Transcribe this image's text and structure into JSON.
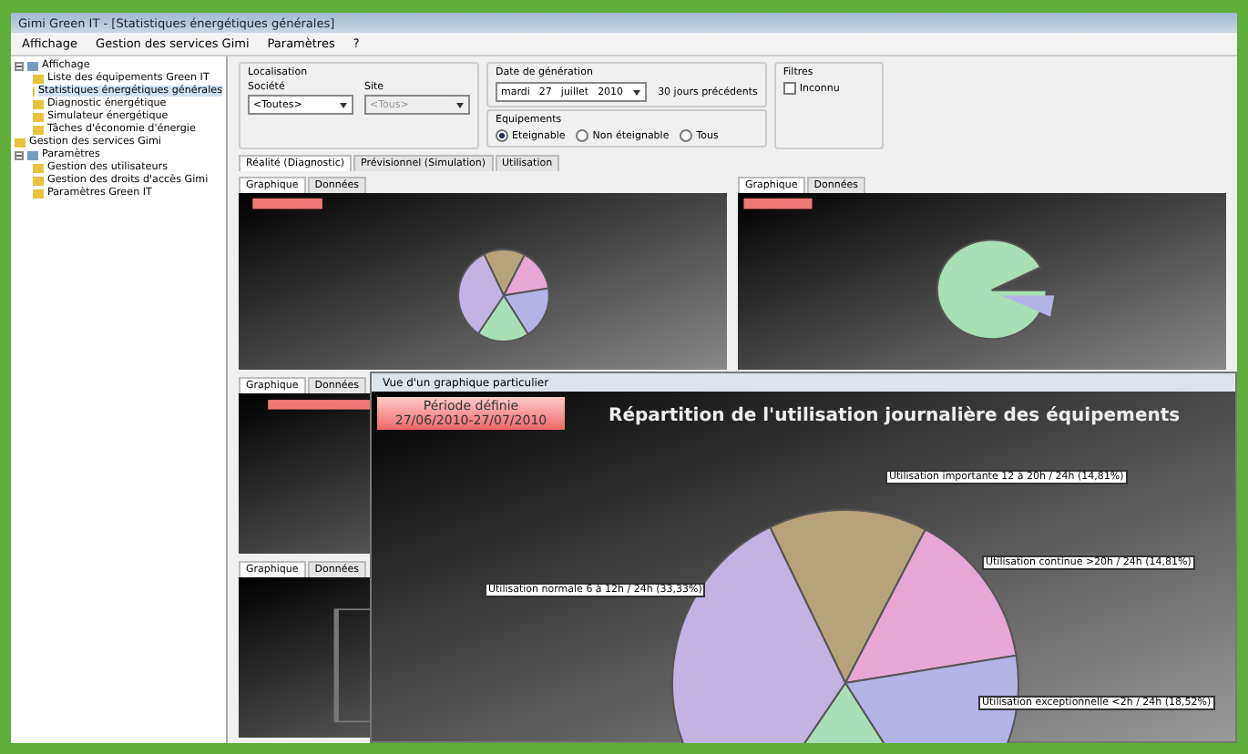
{
  "window": {
    "title": "Gimi Green IT - [Statistiques énergétiques générales]"
  },
  "menu": [
    "Affichage",
    "Gestion des services Gimi",
    "Paramètres",
    "?"
  ],
  "tree": [
    {
      "label": "Affichage",
      "expanded": true,
      "selected": false,
      "children": [
        {
          "label": "Liste des équipements Green IT",
          "selected": false
        },
        {
          "label": "Statistiques énergétiques générales",
          "selected": true
        },
        {
          "label": "Diagnostic énergétique",
          "selected": false
        },
        {
          "label": "Simulateur énergétique",
          "selected": false
        },
        {
          "label": "Tâches d'économie d'énergie",
          "selected": false
        }
      ]
    },
    {
      "label": "Gestion des services Gimi",
      "selected": false
    },
    {
      "label": "Paramètres",
      "expanded": true,
      "selected": false,
      "children": [
        {
          "label": "Gestion des utilisateurs",
          "selected": false
        },
        {
          "label": "Gestion des droits d'accès Gimi",
          "selected": false
        },
        {
          "label": "Paramètres Green IT",
          "selected": false
        }
      ]
    }
  ],
  "localisation": {
    "title": "Localisation",
    "fields": [
      {
        "label": "Société",
        "value": "<Toutes>",
        "disabled": false
      },
      {
        "label": "Site",
        "value": "<Tous>",
        "disabled": true
      }
    ]
  },
  "date": {
    "title": "Date de génération",
    "parts": [
      "mardi",
      "27",
      "juillet",
      "2010"
    ],
    "period": "30 jours précédents"
  },
  "equipements": {
    "title": "Equipements",
    "options": [
      {
        "label": "Eteignable",
        "selected": true
      },
      {
        "label": "Non éteignable",
        "selected": false
      },
      {
        "label": "Tous",
        "selected": false
      }
    ]
  },
  "filtres": {
    "title": "Filtres",
    "options": [
      {
        "label": "Inconnu",
        "checked": false
      }
    ]
  },
  "tabs": [
    {
      "label": "Réalité (Diagnostic)",
      "selected": true
    },
    {
      "label": "Prévisionnel (Simulation)",
      "selected": false
    },
    {
      "label": "Utilisation",
      "selected": false
    }
  ],
  "panels": [
    {
      "kind": "pie",
      "tabs": [
        {
          "label": "Graphique",
          "selected": true
        },
        {
          "label": "Données",
          "selected": false
        }
      ]
    },
    {
      "kind": "bigpie",
      "tabs": [
        {
          "label": "Graphique",
          "selected": true
        },
        {
          "label": "Données",
          "selected": false
        }
      ]
    },
    {
      "kind": "empty",
      "tabs": [
        {
          "label": "Graphique",
          "selected": true
        },
        {
          "label": "Données",
          "selected": false
        }
      ]
    },
    {
      "kind": "grid",
      "tabs": [
        {
          "label": "Graphique",
          "selected": true
        },
        {
          "label": "Données",
          "selected": false
        }
      ]
    }
  ],
  "popup": {
    "title": "Vue d'un graphique particulier",
    "period_label": "Période définie",
    "period": "27/06/2010-27/07/2010",
    "chart_title": "Répartition de l'utilisation journalière des équipements",
    "slices": [
      {
        "label": "Utilisation importante 12 à 20h / 24h (14,81%)",
        "color": "#b8a27a"
      },
      {
        "label": "Utilisation continue >20h / 24h (14,81%)",
        "color": "#e7a6d6"
      },
      {
        "label": "Utilisation exceptionnelle <2h / 24h (18,52%)",
        "color": "#b3b3e6"
      },
      {
        "color": "#a8dfb4"
      },
      {
        "label": "Utilisation normale 6 à 12h / 24h (33,33%)",
        "color": "#c3b3e3"
      }
    ]
  }
}
